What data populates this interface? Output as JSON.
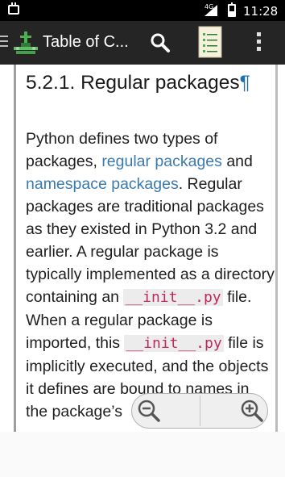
{
  "status_bar": {
    "time": "11:28",
    "network": "4G"
  },
  "toolbar": {
    "title": "Table of C...",
    "search_icon": "search-icon",
    "document_icon": "document-icon",
    "overflow_icon": "overflow-menu-icon",
    "menu_icon": "menu-icon"
  },
  "article": {
    "heading": "5.2.1. Regular packages",
    "pilcrow": "¶",
    "p_text1": "Python defines two types of packages, ",
    "link_regular": "regular packages",
    "p_text2": " and ",
    "link_namespace": "namespace packages",
    "p_text3": ". Regular packages are traditional packages as they existed in Python 3.2 and earlier. A regular package is typically implemented as a directory containing an ",
    "code1": "__init__.py",
    "p_text4": " file. When a regular package is imported, this ",
    "code2": "__init__.py",
    "p_text5": " file is implicitly executed, and the objects it defines are bound to names in the package’s"
  },
  "zoom": {
    "out_icon": "zoom-out-icon",
    "in_icon": "zoom-in-icon"
  }
}
